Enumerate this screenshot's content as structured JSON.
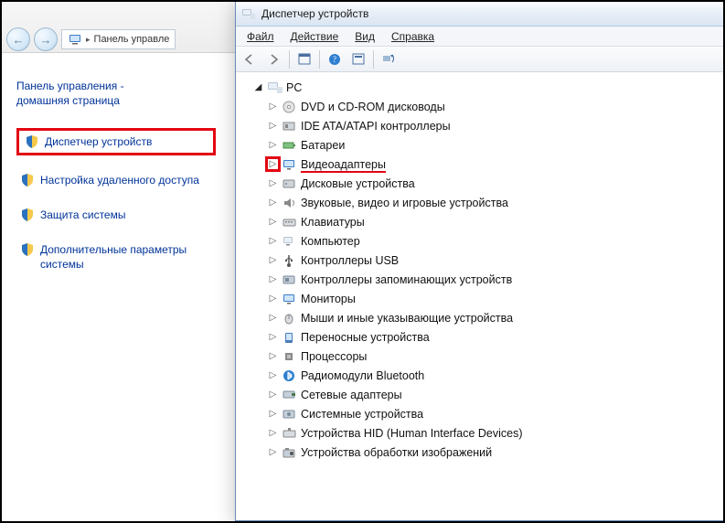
{
  "breadcrumb": {
    "root_label": "Панель управле"
  },
  "cp": {
    "home_line1": "Панель управления -",
    "home_line2": "домашняя страница",
    "links": [
      {
        "label": "Диспетчер устройств"
      },
      {
        "label": "Настройка удаленного доступа"
      },
      {
        "label": "Защита системы"
      },
      {
        "label": "Дополнительные параметры системы"
      }
    ]
  },
  "dm": {
    "title": "Диспетчер устройств",
    "menus": {
      "file": "Файл",
      "action": "Действие",
      "view": "Вид",
      "help": "Справка"
    },
    "root": "PC",
    "nodes": [
      {
        "label": "DVD и CD-ROM дисководы"
      },
      {
        "label": "IDE ATA/ATAPI контроллеры"
      },
      {
        "label": "Батареи"
      },
      {
        "label": "Видеоадаптеры"
      },
      {
        "label": "Дисковые устройства"
      },
      {
        "label": "Звуковые, видео и игровые устройства"
      },
      {
        "label": "Клавиатуры"
      },
      {
        "label": "Компьютер"
      },
      {
        "label": "Контроллеры USB"
      },
      {
        "label": "Контроллеры запоминающих устройств"
      },
      {
        "label": "Мониторы"
      },
      {
        "label": "Мыши и иные указывающие устройства"
      },
      {
        "label": "Переносные устройства"
      },
      {
        "label": "Процессоры"
      },
      {
        "label": "Радиомодули Bluetooth"
      },
      {
        "label": "Сетевые адаптеры"
      },
      {
        "label": "Системные устройства"
      },
      {
        "label": "Устройства HID (Human Interface Devices)"
      },
      {
        "label": "Устройства обработки изображений"
      }
    ]
  }
}
